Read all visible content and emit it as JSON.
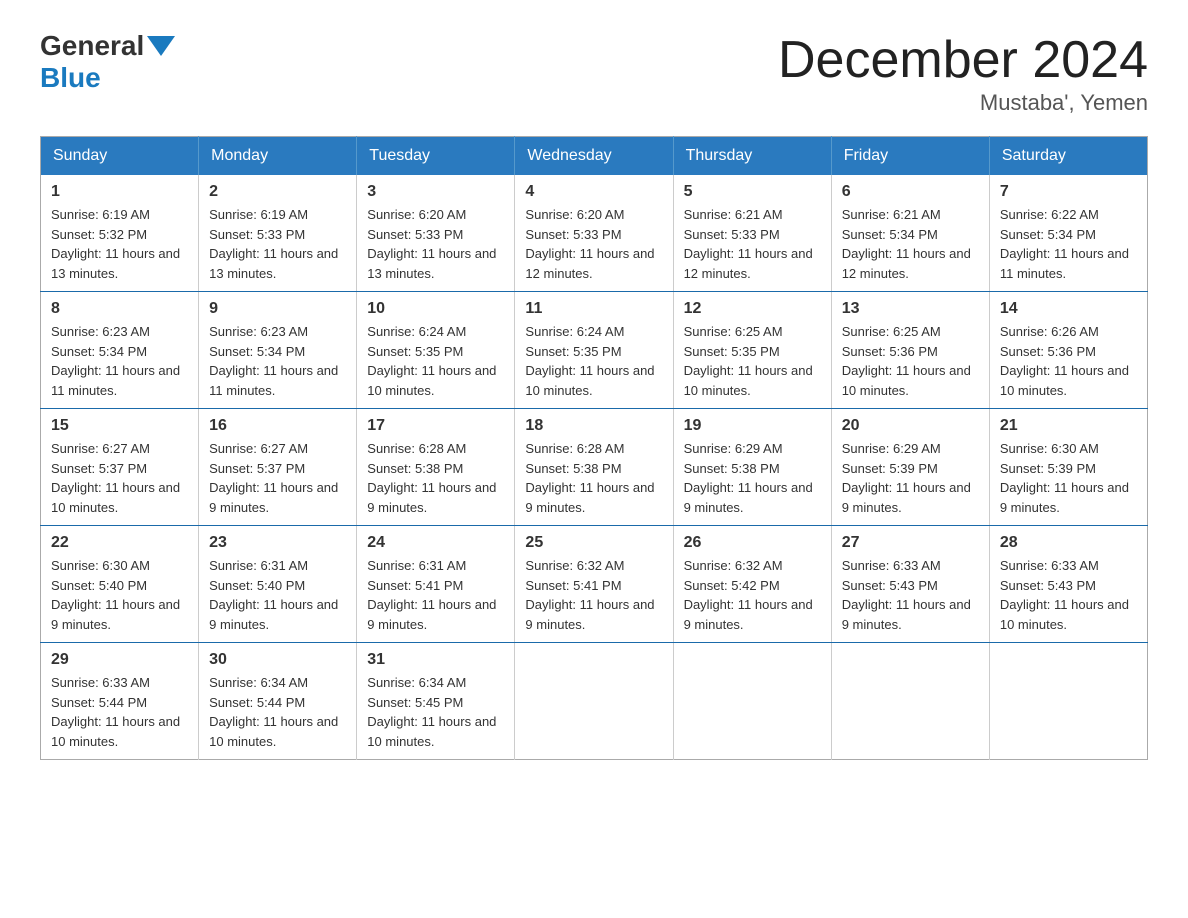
{
  "header": {
    "logo": {
      "general": "General",
      "blue": "Blue"
    },
    "title": "December 2024",
    "location": "Mustaba', Yemen"
  },
  "days_of_week": [
    "Sunday",
    "Monday",
    "Tuesday",
    "Wednesday",
    "Thursday",
    "Friday",
    "Saturday"
  ],
  "weeks": [
    [
      {
        "day": "1",
        "sunrise": "6:19 AM",
        "sunset": "5:32 PM",
        "daylight": "11 hours and 13 minutes."
      },
      {
        "day": "2",
        "sunrise": "6:19 AM",
        "sunset": "5:33 PM",
        "daylight": "11 hours and 13 minutes."
      },
      {
        "day": "3",
        "sunrise": "6:20 AM",
        "sunset": "5:33 PM",
        "daylight": "11 hours and 13 minutes."
      },
      {
        "day": "4",
        "sunrise": "6:20 AM",
        "sunset": "5:33 PM",
        "daylight": "11 hours and 12 minutes."
      },
      {
        "day": "5",
        "sunrise": "6:21 AM",
        "sunset": "5:33 PM",
        "daylight": "11 hours and 12 minutes."
      },
      {
        "day": "6",
        "sunrise": "6:21 AM",
        "sunset": "5:34 PM",
        "daylight": "11 hours and 12 minutes."
      },
      {
        "day": "7",
        "sunrise": "6:22 AM",
        "sunset": "5:34 PM",
        "daylight": "11 hours and 11 minutes."
      }
    ],
    [
      {
        "day": "8",
        "sunrise": "6:23 AM",
        "sunset": "5:34 PM",
        "daylight": "11 hours and 11 minutes."
      },
      {
        "day": "9",
        "sunrise": "6:23 AM",
        "sunset": "5:34 PM",
        "daylight": "11 hours and 11 minutes."
      },
      {
        "day": "10",
        "sunrise": "6:24 AM",
        "sunset": "5:35 PM",
        "daylight": "11 hours and 10 minutes."
      },
      {
        "day": "11",
        "sunrise": "6:24 AM",
        "sunset": "5:35 PM",
        "daylight": "11 hours and 10 minutes."
      },
      {
        "day": "12",
        "sunrise": "6:25 AM",
        "sunset": "5:35 PM",
        "daylight": "11 hours and 10 minutes."
      },
      {
        "day": "13",
        "sunrise": "6:25 AM",
        "sunset": "5:36 PM",
        "daylight": "11 hours and 10 minutes."
      },
      {
        "day": "14",
        "sunrise": "6:26 AM",
        "sunset": "5:36 PM",
        "daylight": "11 hours and 10 minutes."
      }
    ],
    [
      {
        "day": "15",
        "sunrise": "6:27 AM",
        "sunset": "5:37 PM",
        "daylight": "11 hours and 10 minutes."
      },
      {
        "day": "16",
        "sunrise": "6:27 AM",
        "sunset": "5:37 PM",
        "daylight": "11 hours and 9 minutes."
      },
      {
        "day": "17",
        "sunrise": "6:28 AM",
        "sunset": "5:38 PM",
        "daylight": "11 hours and 9 minutes."
      },
      {
        "day": "18",
        "sunrise": "6:28 AM",
        "sunset": "5:38 PM",
        "daylight": "11 hours and 9 minutes."
      },
      {
        "day": "19",
        "sunrise": "6:29 AM",
        "sunset": "5:38 PM",
        "daylight": "11 hours and 9 minutes."
      },
      {
        "day": "20",
        "sunrise": "6:29 AM",
        "sunset": "5:39 PM",
        "daylight": "11 hours and 9 minutes."
      },
      {
        "day": "21",
        "sunrise": "6:30 AM",
        "sunset": "5:39 PM",
        "daylight": "11 hours and 9 minutes."
      }
    ],
    [
      {
        "day": "22",
        "sunrise": "6:30 AM",
        "sunset": "5:40 PM",
        "daylight": "11 hours and 9 minutes."
      },
      {
        "day": "23",
        "sunrise": "6:31 AM",
        "sunset": "5:40 PM",
        "daylight": "11 hours and 9 minutes."
      },
      {
        "day": "24",
        "sunrise": "6:31 AM",
        "sunset": "5:41 PM",
        "daylight": "11 hours and 9 minutes."
      },
      {
        "day": "25",
        "sunrise": "6:32 AM",
        "sunset": "5:41 PM",
        "daylight": "11 hours and 9 minutes."
      },
      {
        "day": "26",
        "sunrise": "6:32 AM",
        "sunset": "5:42 PM",
        "daylight": "11 hours and 9 minutes."
      },
      {
        "day": "27",
        "sunrise": "6:33 AM",
        "sunset": "5:43 PM",
        "daylight": "11 hours and 9 minutes."
      },
      {
        "day": "28",
        "sunrise": "6:33 AM",
        "sunset": "5:43 PM",
        "daylight": "11 hours and 10 minutes."
      }
    ],
    [
      {
        "day": "29",
        "sunrise": "6:33 AM",
        "sunset": "5:44 PM",
        "daylight": "11 hours and 10 minutes."
      },
      {
        "day": "30",
        "sunrise": "6:34 AM",
        "sunset": "5:44 PM",
        "daylight": "11 hours and 10 minutes."
      },
      {
        "day": "31",
        "sunrise": "6:34 AM",
        "sunset": "5:45 PM",
        "daylight": "11 hours and 10 minutes."
      },
      null,
      null,
      null,
      null
    ]
  ]
}
